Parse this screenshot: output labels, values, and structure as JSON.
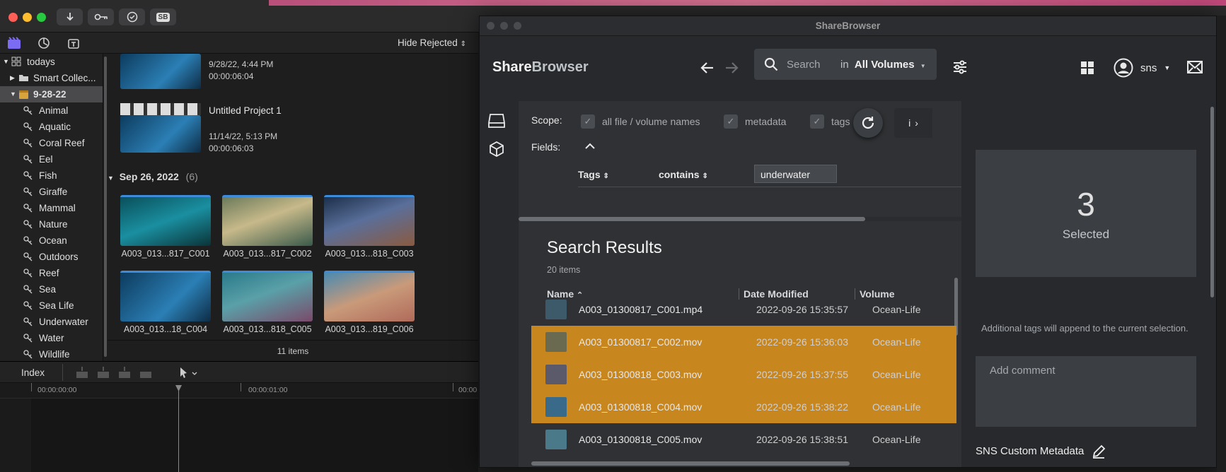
{
  "fcp": {
    "title_buttons": [
      "download-icon",
      "key-icon",
      "checkmark-icon",
      "sb-icon"
    ],
    "sb_button_label": "SB",
    "filter_label": "Hide Rejected",
    "sidebar": {
      "library": "todays",
      "smart_collections": "Smart Collec...",
      "event": "9-28-22",
      "keywords": [
        "Animal",
        "Aquatic",
        "Coral Reef",
        "Eel",
        "Fish",
        "Giraffe",
        "Mammal",
        "Nature",
        "Ocean",
        "Outdoors",
        "Reef",
        "Sea",
        "Sea Life",
        "Underwater",
        "Water",
        "Wildlife"
      ]
    },
    "browser": {
      "top_clip": {
        "date": "9/28/22, 4:44 PM",
        "duration": "00:00:06:04"
      },
      "project": {
        "name": "Untitled Project 1",
        "date": "11/14/22, 5:13 PM",
        "duration": "00:00:06:03"
      },
      "group_label": "Sep 26, 2022",
      "group_count": "(6)",
      "clips": [
        "A003_013...817_C001",
        "A003_013...817_C002",
        "A003_013...818_C003",
        "A003_013...18_C004",
        "A003_013...818_C005",
        "A003_013...819_C006"
      ],
      "items_count": "11 items"
    },
    "timeline": {
      "index_label": "Index",
      "timecodes": [
        "00:00:00:00",
        "00:00:01:00",
        "00:00"
      ]
    }
  },
  "sharebrowser": {
    "window_title": "ShareBrowser",
    "logo_share": "Share",
    "logo_browser": "Browser",
    "search": {
      "placeholder": "Search",
      "in_label": "in",
      "scope_value": "All Volumes"
    },
    "user": "sns",
    "scope_label": "Scope:",
    "scope_options": [
      "all file / volume names",
      "metadata",
      "tags"
    ],
    "fields_label": "Fields:",
    "field_row": {
      "field": "Tags",
      "operator": "contains",
      "value": "underwater"
    },
    "info_label": "i",
    "results": {
      "title": "Search Results",
      "count": "20 items",
      "columns": [
        "Name",
        "Date Modified",
        "Volume"
      ],
      "rows": [
        {
          "name": "A003_01300817_C001.mp4",
          "date": "2022-09-26 15:35:57",
          "volume": "Ocean-Life",
          "selected": false
        },
        {
          "name": "A003_01300817_C002.mov",
          "date": "2022-09-26 15:36:03",
          "volume": "Ocean-Life",
          "selected": true
        },
        {
          "name": "A003_01300818_C003.mov",
          "date": "2022-09-26 15:37:55",
          "volume": "Ocean-Life",
          "selected": true
        },
        {
          "name": "A003_01300818_C004.mov",
          "date": "2022-09-26 15:38:22",
          "volume": "Ocean-Life",
          "selected": true
        },
        {
          "name": "A003_01300818_C005.mov",
          "date": "2022-09-26 15:38:51",
          "volume": "Ocean-Life",
          "selected": false
        }
      ]
    },
    "selection": {
      "count": "3",
      "label": "Selected"
    },
    "tags_note": "Additional tags will append to the current selection.",
    "comment_placeholder": "Add comment",
    "custom_metadata_label": "SNS Custom Metadata"
  },
  "colors": {
    "selected_row": "#c8861f",
    "accent_blue": "#3d8bd9"
  }
}
